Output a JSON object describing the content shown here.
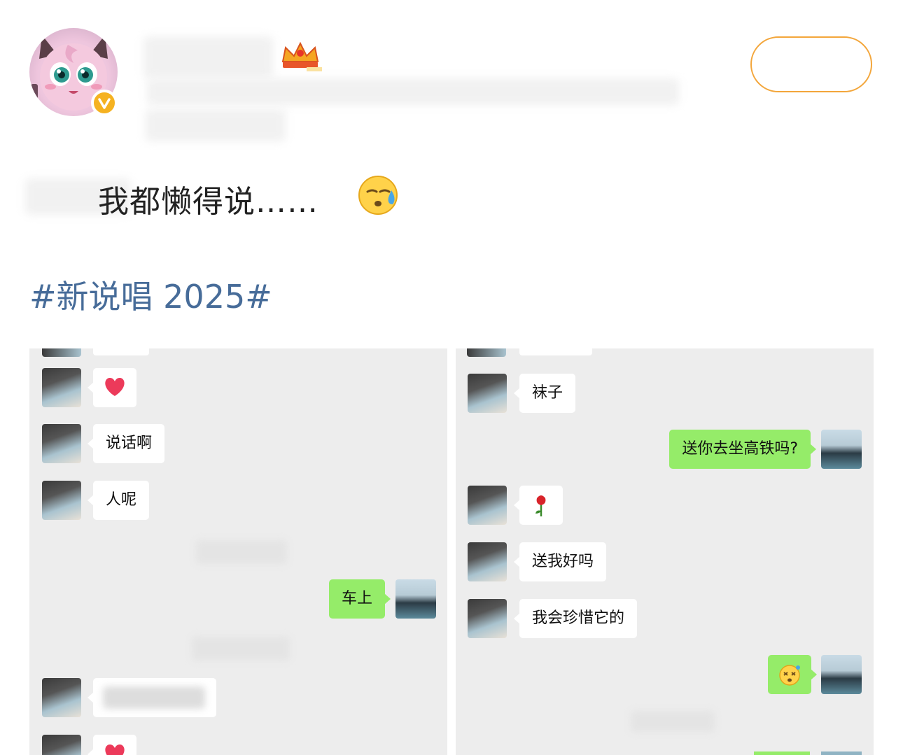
{
  "post": {
    "text": "我都懒得说……",
    "hashtag": "#新说唱 2025#"
  },
  "left_chat": {
    "messages": [
      {
        "from": "them",
        "type": "icon",
        "icon": "red-heart-icon"
      },
      {
        "from": "them",
        "type": "text",
        "text": "说话啊"
      },
      {
        "from": "them",
        "type": "text",
        "text": "人呢"
      },
      {
        "from": "me",
        "type": "text",
        "text": "车上"
      },
      {
        "from": "them",
        "type": "icon",
        "icon": "red-heart-icon"
      }
    ]
  },
  "right_chat": {
    "messages": [
      {
        "from": "them",
        "type": "text",
        "text": "袜子"
      },
      {
        "from": "me",
        "type": "text",
        "text": "送你去坐高铁吗?"
      },
      {
        "from": "them",
        "type": "icon",
        "icon": "rose-icon"
      },
      {
        "from": "them",
        "type": "text",
        "text": "送我好吗"
      },
      {
        "from": "them",
        "type": "text",
        "text": "我会珍惜它的"
      },
      {
        "from": "me",
        "type": "icon",
        "icon": "dizzy-face-icon"
      }
    ]
  },
  "colors": {
    "hashtag": "#476c99",
    "outgoing_bubble": "#95ec69",
    "incoming_bubble": "#ffffff",
    "chat_background": "#ededed",
    "follow_button_border": "#f3a63b",
    "verified_badge": "#f5b221"
  }
}
